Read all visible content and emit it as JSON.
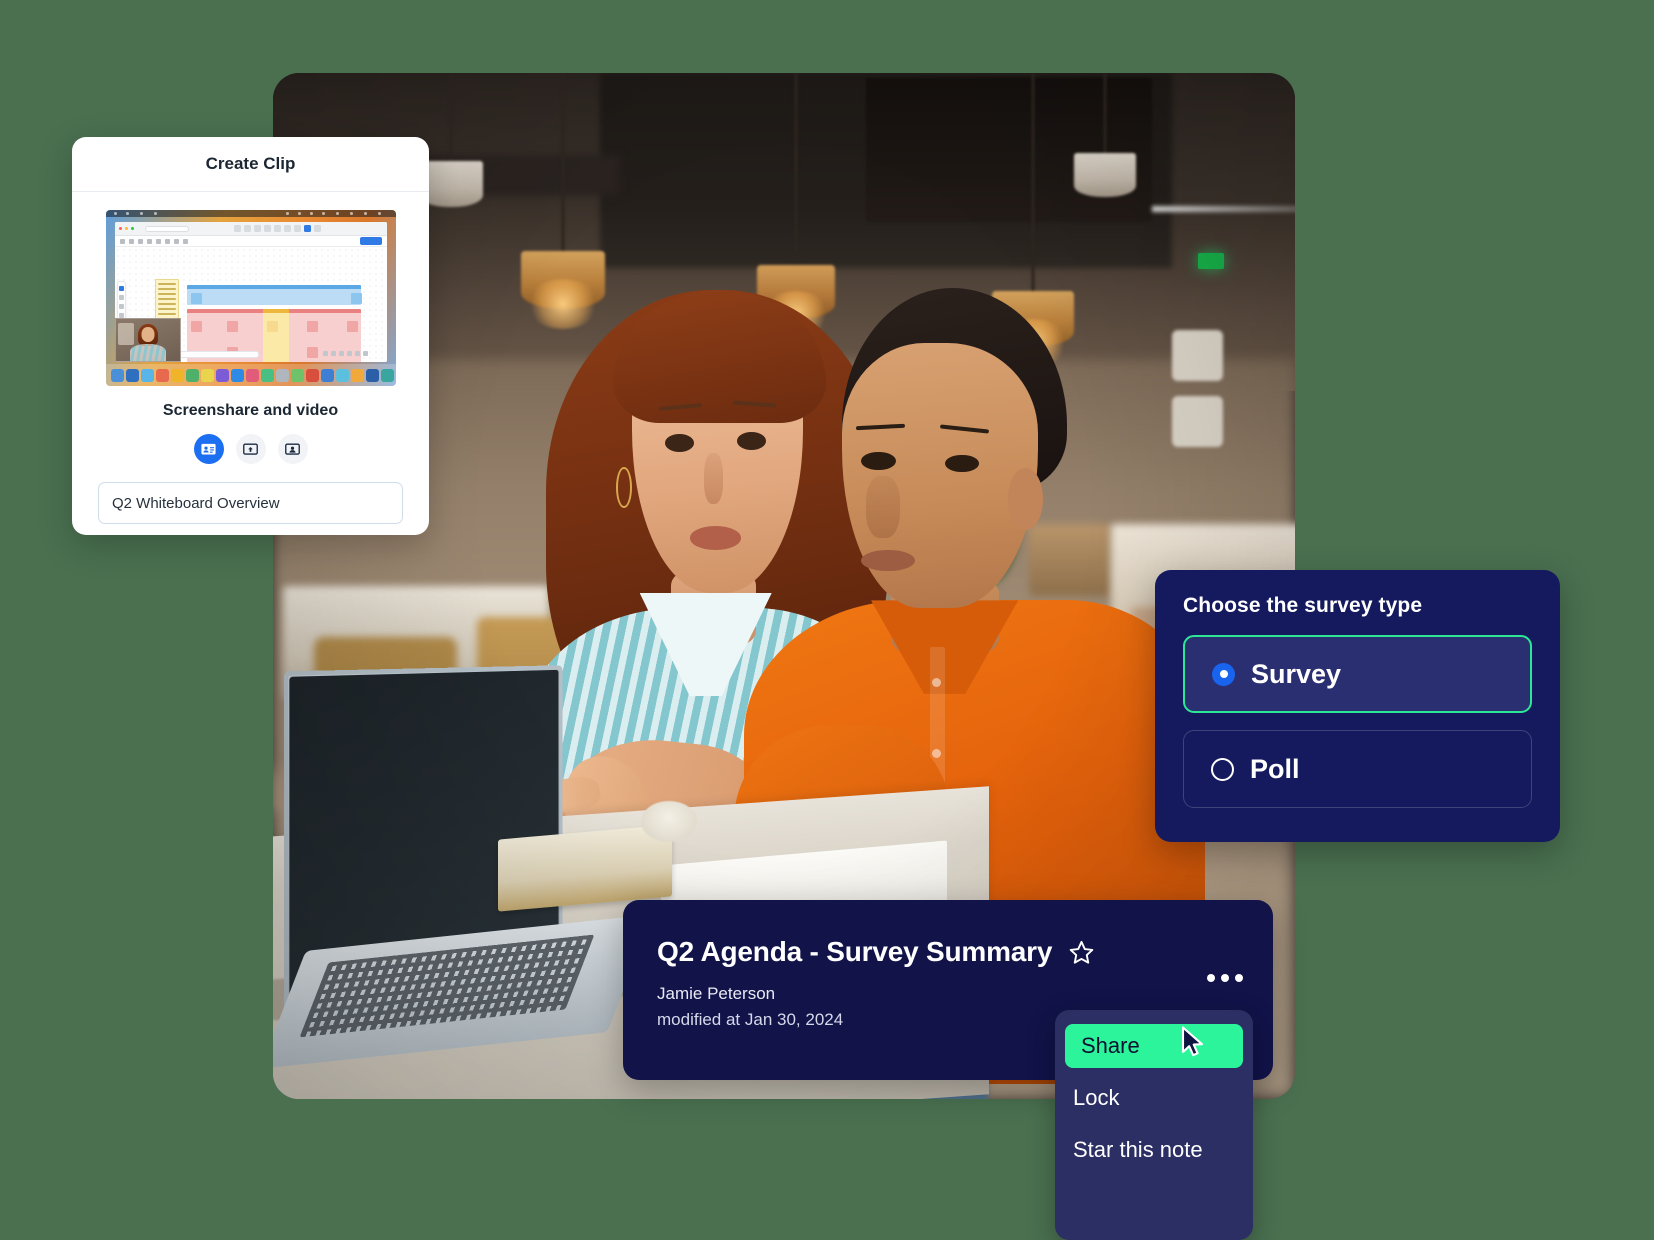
{
  "theme": {
    "page_background": "#4a7050",
    "accent_blue": "#1d6ff2",
    "accent_green": "#2cf49b",
    "panel_navy": "#151a5e",
    "card_navy": "#111349",
    "menu_purple": "#2c2f63"
  },
  "clip_card": {
    "title": "Create Clip",
    "thumbnail_alt": "whiteboard-screenshare-thumbnail",
    "subtitle": "Screenshare and video",
    "modes": [
      {
        "name": "screenshare-and-video-mode",
        "icon": "screen-with-person-icon",
        "selected": true
      },
      {
        "name": "screenshare-only-mode",
        "icon": "screen-upload-icon",
        "selected": false
      },
      {
        "name": "video-only-mode",
        "icon": "person-frame-icon",
        "selected": false
      }
    ],
    "name_input": {
      "value": "Q2 Whiteboard Overview",
      "placeholder": "Clip name"
    }
  },
  "survey_panel": {
    "heading": "Choose the survey type",
    "options": [
      {
        "label": "Survey",
        "selected": true
      },
      {
        "label": "Poll",
        "selected": false
      }
    ]
  },
  "note_card": {
    "title": "Q2 Agenda - Survey Summary",
    "star_icon": "star-outline-icon",
    "author": "Jamie Peterson",
    "modified": "modified at Jan 30, 2024",
    "overflow_icon": "ellipsis-icon"
  },
  "context_menu": {
    "items": [
      {
        "label": "Share",
        "highlighted": true
      },
      {
        "label": "Lock",
        "highlighted": false
      },
      {
        "label": "Star this note",
        "highlighted": false
      }
    ]
  },
  "cursor": {
    "icon": "mouse-pointer-icon"
  }
}
